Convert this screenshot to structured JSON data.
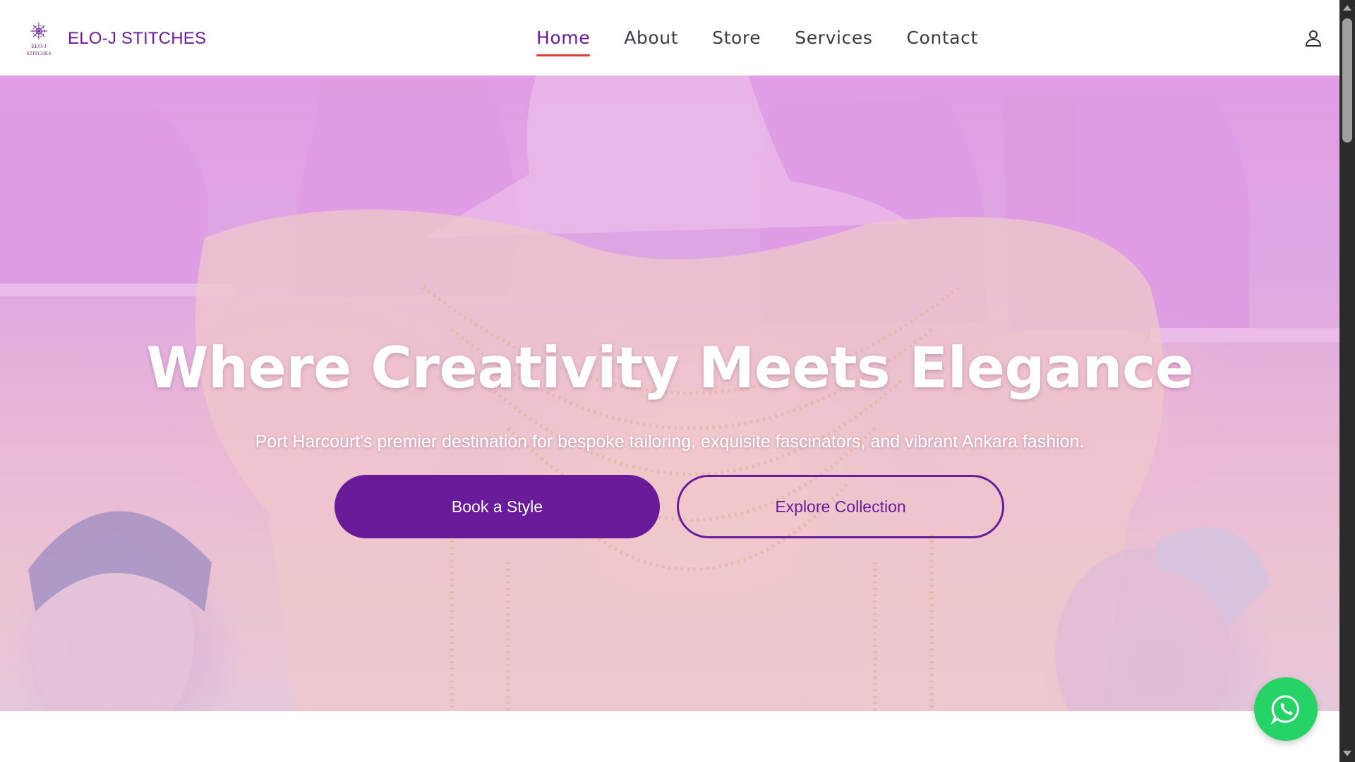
{
  "brand": {
    "name": "ELO-J STITCHES",
    "logo_text_line1": "ELO-J",
    "logo_text_line2": "STITCHES"
  },
  "nav": {
    "items": [
      {
        "label": "Home",
        "active": true
      },
      {
        "label": "About",
        "active": false
      },
      {
        "label": "Store",
        "active": false
      },
      {
        "label": "Services",
        "active": false
      },
      {
        "label": "Contact",
        "active": false
      }
    ],
    "user_icon": "user-icon"
  },
  "hero": {
    "title": "Where Creativity Meets Elegance",
    "subtitle": "Port Harcourt's premier destination for bespoke tailoring, exquisite fascinators, and vibrant Ankara fashion.",
    "primary_button": "Book a Style",
    "secondary_button": "Explore Collection"
  },
  "floating": {
    "whatsapp_icon": "whatsapp-icon"
  },
  "colors": {
    "brand_purple": "#6a1b9a",
    "active_underline": "#e53935",
    "whatsapp_green": "#25d366"
  }
}
